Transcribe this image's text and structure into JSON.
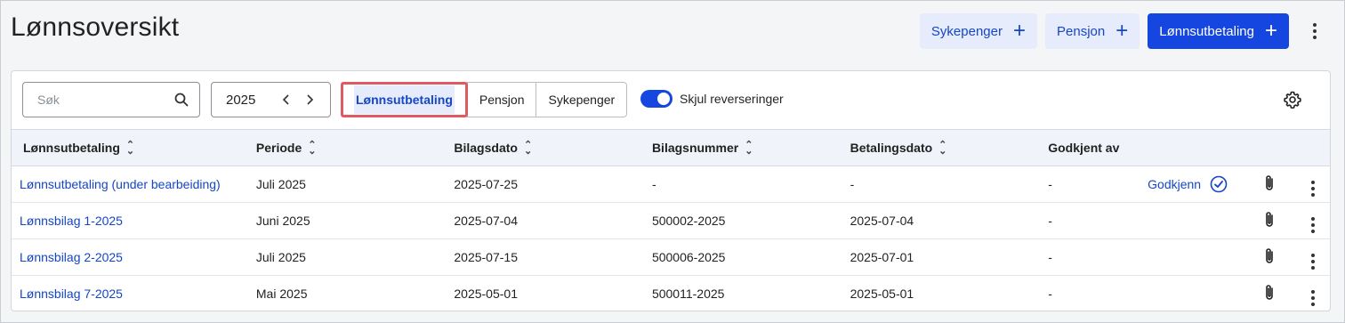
{
  "page": {
    "title": "Lønnsoversikt"
  },
  "top_actions": {
    "sick_pay_label": "Sykepenger",
    "pension_label": "Pensjon",
    "payroll_label": "Lønnsutbetaling",
    "icons": [
      "plus-icon",
      "more-vertical-icon"
    ]
  },
  "toolbar": {
    "search": {
      "placeholder": "Søk",
      "value": ""
    },
    "year": {
      "value": "2025"
    },
    "segments": {
      "active": "Lønnsutbetaling",
      "pension": "Pensjon",
      "sick_pay": "Sykepenger"
    },
    "toggle": {
      "label": "Skjul reverseringer",
      "on": true
    }
  },
  "table": {
    "headers": {
      "payroll": "Lønnsutbetaling",
      "period": "Periode",
      "voucher_date": "Bilagsdato",
      "voucher_number": "Bilagsnummer",
      "payment_date": "Betalingsdato",
      "approved_by": "Godkjent av"
    },
    "rows": [
      {
        "name": "Lønnsutbetaling (under bearbeiding)",
        "period": "Juli 2025",
        "voucher_date": "2025-07-25",
        "voucher_number": "-",
        "payment_date": "-",
        "approved_by": "-",
        "approve_label": "Godkjenn"
      },
      {
        "name": "Lønnsbilag 1-2025",
        "period": "Juni 2025",
        "voucher_date": "2025-07-04",
        "voucher_number": "500002-2025",
        "payment_date": "2025-07-04",
        "approved_by": "-"
      },
      {
        "name": "Lønnsbilag 2-2025",
        "period": "Juli 2025",
        "voucher_date": "2025-07-15",
        "voucher_number": "500006-2025",
        "payment_date": "2025-07-01",
        "approved_by": "-"
      },
      {
        "name": "Lønnsbilag 7-2025",
        "period": "Mai 2025",
        "voucher_date": "2025-05-01",
        "voucher_number": "500011-2025",
        "payment_date": "2025-05-01",
        "approved_by": "-"
      }
    ]
  },
  "colors": {
    "primary": "#1547e0",
    "link": "#1546c8",
    "soft_button": "#e6ecfb",
    "highlight_outline": "#e05a62",
    "header_bg": "#f0f3fa"
  }
}
